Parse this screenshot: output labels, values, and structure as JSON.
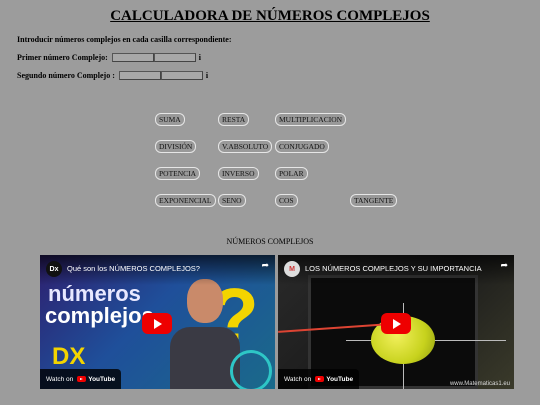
{
  "page": {
    "title": "CALCULADORA DE NÚMEROS COMPLEJOS",
    "instructions": "Introducir números complejos en cada casilla correspondiente:"
  },
  "inputs": {
    "first_label": "Primer número Complejo:",
    "second_label": "Segundo número Complejo :",
    "imaginary_unit": "i",
    "first_real": "",
    "first_imag": "",
    "second_real": "",
    "second_imag": ""
  },
  "operations": {
    "suma": "SUMA",
    "resta": "RESTA",
    "multiplicacion": "MULTIPLICACION",
    "division": "DIVISIÓN",
    "vabsoluto": "V.ABSOLUTO",
    "conjugado": "CONJUGADO",
    "potencia": "POTENCIA",
    "inverso": "INVERSO",
    "polar": "POLAR",
    "exponencial": "EXPONENCIAL",
    "seno": "SENO",
    "cos": "COS",
    "tangente": "TANGENTE"
  },
  "videos": {
    "section_title": "NÚMEROS COMPLEJOS",
    "watch_on": "Watch on",
    "youtube": "YouTube",
    "video1": {
      "channel": "Dx",
      "title": "Qué son los NÚMEROS COMPLEJOS?",
      "thumb_line1": "números",
      "thumb_line2": "complejos",
      "thumb_badge": "DX"
    },
    "video2": {
      "channel": "M",
      "title": "LOS NÚMEROS COMPLEJOS Y SU IMPORTANCIA",
      "watermark": "www.Matematicas1.eu"
    }
  },
  "colors": {
    "background": "#9c9c9c",
    "play_button": "#ee0000"
  }
}
